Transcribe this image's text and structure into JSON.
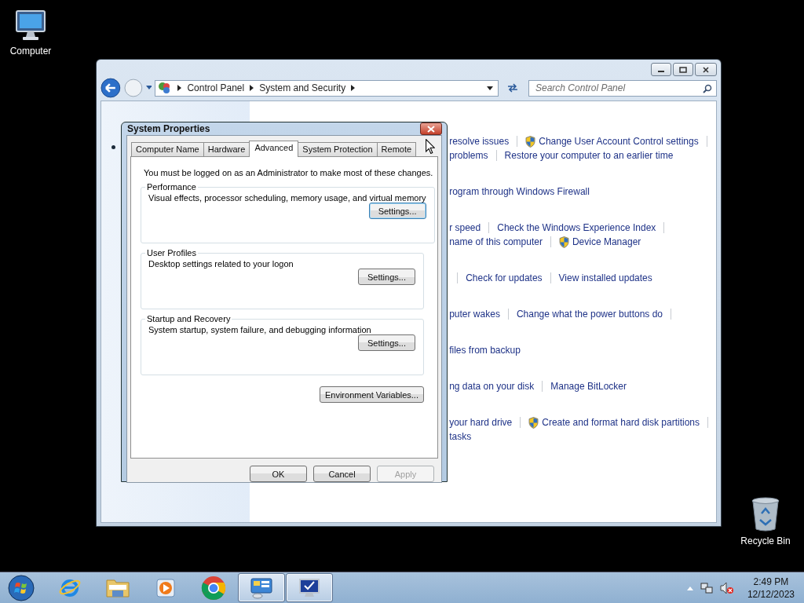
{
  "desktop_icons": [
    {
      "label": "Computer",
      "kind": "computer"
    },
    {
      "label": "Recycle Bin",
      "kind": "recycle-bin"
    }
  ],
  "explorer": {
    "breadcrumb": [
      "Control Panel",
      "System and Security"
    ],
    "search": {
      "placeholder": "Search Control Panel"
    },
    "task_groups": [
      {
        "lines": [
          {
            "lead": false,
            "trail": true,
            "links": [
              {
                "text": "resolve issues",
                "shield": false
              },
              {
                "text": "Change User Account Control settings",
                "shield": true
              }
            ]
          },
          {
            "lead": false,
            "trail": false,
            "links": [
              {
                "text": "problems",
                "shield": false
              },
              {
                "text": "Restore your computer to an earlier time",
                "shield": false
              }
            ]
          }
        ]
      },
      {
        "lines": [
          {
            "lead": false,
            "trail": false,
            "links": [
              {
                "text": "rogram through Windows Firewall",
                "shield": false
              }
            ]
          }
        ]
      },
      {
        "lines": [
          {
            "lead": false,
            "trail": true,
            "links": [
              {
                "text": "r speed",
                "shield": false
              },
              {
                "text": "Check the Windows Experience Index",
                "shield": false
              }
            ]
          },
          {
            "lead": false,
            "trail": false,
            "links": [
              {
                "text": "name of this computer",
                "shield": false
              },
              {
                "text": "Device Manager",
                "shield": true
              }
            ]
          }
        ]
      },
      {
        "lines": [
          {
            "lead": true,
            "trail": false,
            "links": [
              {
                "text": "Check for updates",
                "shield": false
              },
              {
                "text": "View installed updates",
                "shield": false
              }
            ]
          }
        ]
      },
      {
        "lines": [
          {
            "lead": false,
            "trail": true,
            "links": [
              {
                "text": "puter wakes",
                "shield": false
              },
              {
                "text": "Change what the power buttons do",
                "shield": false
              }
            ]
          }
        ]
      },
      {
        "lines": [
          {
            "lead": false,
            "trail": false,
            "links": [
              {
                "text": "files from backup",
                "shield": false
              }
            ]
          }
        ]
      },
      {
        "lines": [
          {
            "lead": false,
            "trail": false,
            "links": [
              {
                "text": "ng data on your disk",
                "shield": false
              },
              {
                "text": "Manage BitLocker",
                "shield": false
              }
            ]
          }
        ]
      },
      {
        "lines": [
          {
            "lead": false,
            "trail": true,
            "links": [
              {
                "text": "your hard drive",
                "shield": false
              },
              {
                "text": "Create and format hard disk partitions",
                "shield": true
              }
            ]
          },
          {
            "lead": false,
            "trail": false,
            "links": [
              {
                "text": "tasks",
                "shield": false
              }
            ]
          }
        ]
      }
    ]
  },
  "dialog": {
    "title": "System Properties",
    "tabs": [
      {
        "label": "Computer Name",
        "selected": false
      },
      {
        "label": "Hardware",
        "selected": false
      },
      {
        "label": "Advanced",
        "selected": true
      },
      {
        "label": "System Protection",
        "selected": false
      },
      {
        "label": "Remote",
        "selected": false
      }
    ],
    "notice": "You must be logged on as an Administrator to make most of these changes.",
    "groups": [
      {
        "title": "Performance",
        "description": "Visual effects, processor scheduling, memory usage, and virtual memory",
        "button": "Settings...",
        "focused": true
      },
      {
        "title": "User Profiles",
        "description": "Desktop settings related to your logon",
        "button": "Settings...",
        "focused": false
      },
      {
        "title": "Startup and Recovery",
        "description": "System startup, system failure, and debugging information",
        "button": "Settings...",
        "focused": false
      }
    ],
    "env_button": "Environment Variables...",
    "buttons": [
      {
        "label": "OK",
        "disabled": false
      },
      {
        "label": "Cancel",
        "disabled": false
      },
      {
        "label": "Apply",
        "disabled": true
      }
    ]
  },
  "taskbar": {
    "apps": [
      {
        "kind": "ie",
        "open": false
      },
      {
        "kind": "folder",
        "open": false
      },
      {
        "kind": "media",
        "open": false
      },
      {
        "kind": "chrome",
        "open": false
      },
      {
        "kind": "control-panel",
        "open": true
      },
      {
        "kind": "system",
        "open": true
      }
    ],
    "clock": {
      "time": "2:49 PM",
      "date": "12/12/2023"
    }
  }
}
